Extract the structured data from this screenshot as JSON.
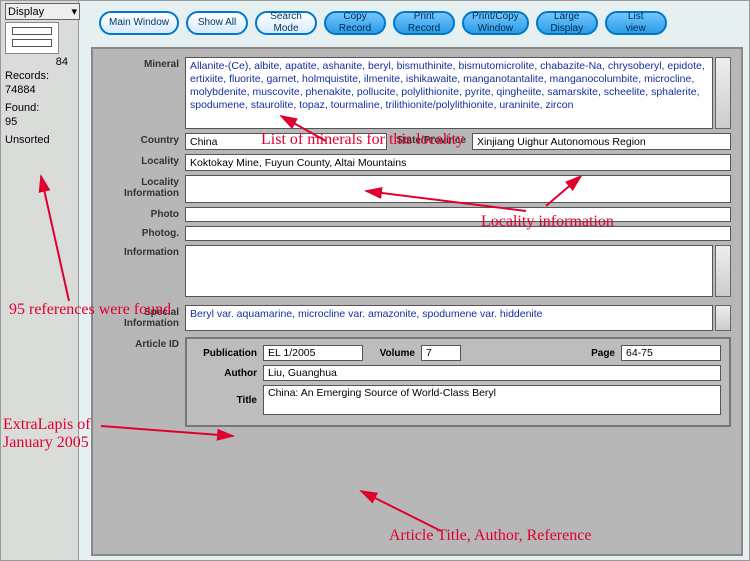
{
  "side": {
    "display_label": "Display",
    "record_preview_count": "84",
    "records_label": "Records:",
    "records_value": "74884",
    "found_label": "Found:",
    "found_value": "95",
    "sorted_label": "Unsorted"
  },
  "toolbar": {
    "b0": "Main Window",
    "b1": "Show All",
    "b2": "Search\nMode",
    "b3": "Copy\nRecord",
    "b4": "Print\nRecord",
    "b5": "Print/Copy\nWindow",
    "b6": "Large\nDisplay",
    "b7": "List\nview"
  },
  "labels": {
    "mineral": "Mineral",
    "country": "Country",
    "state": "State/Province",
    "locality": "Locality",
    "locinfo": "Locality\nInformation",
    "photo": "Photo",
    "photog": "Photog.",
    "info": "Information",
    "special": "Special\nInformation",
    "article": "Article ID",
    "publication": "Publication",
    "volume": "Volume",
    "page": "Page",
    "author": "Author",
    "title": "Title"
  },
  "record": {
    "mineral_list": "Allanite-(Ce), albite, apatite, ashanite, beryl, bismuthinite, bismutomicrolite, chabazite-Na, chrysoberyl, epidote, ertixiite, fluorite, garnet, holmquistite, ilmenite, ishikawaite, manganotantalite, manganocolumbite, microcline, molybdenite, muscovite, phenakite, pollucite, polylithionite, pyrite, qingheiite, samarskite, scheelite, sphalerite, spodumene, staurolite, topaz, tourmaline, trilithionite/polylithionite, uraninite, zircon",
    "country": "China",
    "state": "Xinjiang Uighur Autonomous Region",
    "locality": "Koktokay Mine, Fuyun County, Altai Mountains",
    "special": "Beryl var. aquamarine, microcline var. amazonite, spodumene var. hiddenite",
    "publication": "EL 1/2005",
    "volume": "7",
    "page": "64-75",
    "author": "Liu, Guanghua",
    "title": "China: An Emerging Source of World-Class Beryl"
  },
  "annotations": {
    "a1": "List of minerals for this locality",
    "a2": "Locality information",
    "a3": "95 references were found",
    "a4": "ExtraLapis of January 2005",
    "a5": "Article Title, Author, Reference"
  }
}
